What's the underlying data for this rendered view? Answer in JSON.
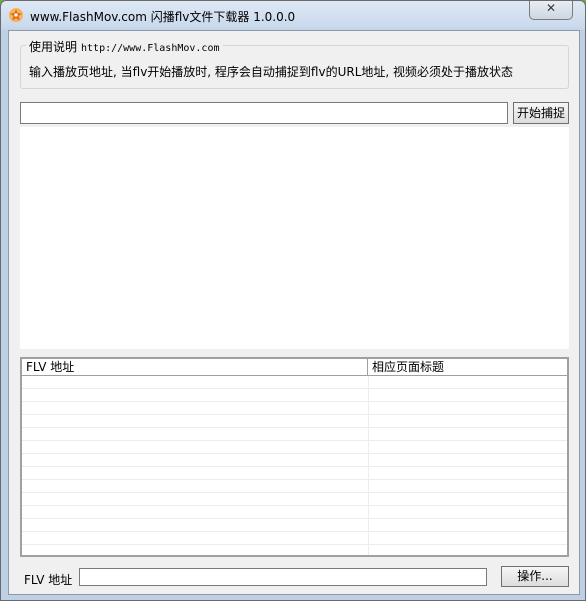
{
  "window": {
    "title": "www.FlashMov.com 闪播flv文件下载器 1.0.0.0",
    "close_symbol": "✕",
    "icon": "flashmov-app-icon"
  },
  "instructions": {
    "legend": "使用说明",
    "legend_url": "http://www.FlashMov.com",
    "text": "输入播放页地址, 当flv开始播放时, 程序会自动捕捉到flv的URL地址, 视频必须处于播放状态"
  },
  "capture": {
    "url_value": "",
    "button_label": "开始捕捉"
  },
  "flv_list": {
    "columns": [
      "FLV 地址",
      "相应页面标题"
    ],
    "rows": []
  },
  "bottom": {
    "label": "FLV 地址",
    "field_value": "",
    "action_button": "操作..."
  },
  "colors": {
    "window_frame": "#c9d9ec",
    "client_bg": "#f0f0f0",
    "desktop_bg": "#6fa84a"
  }
}
